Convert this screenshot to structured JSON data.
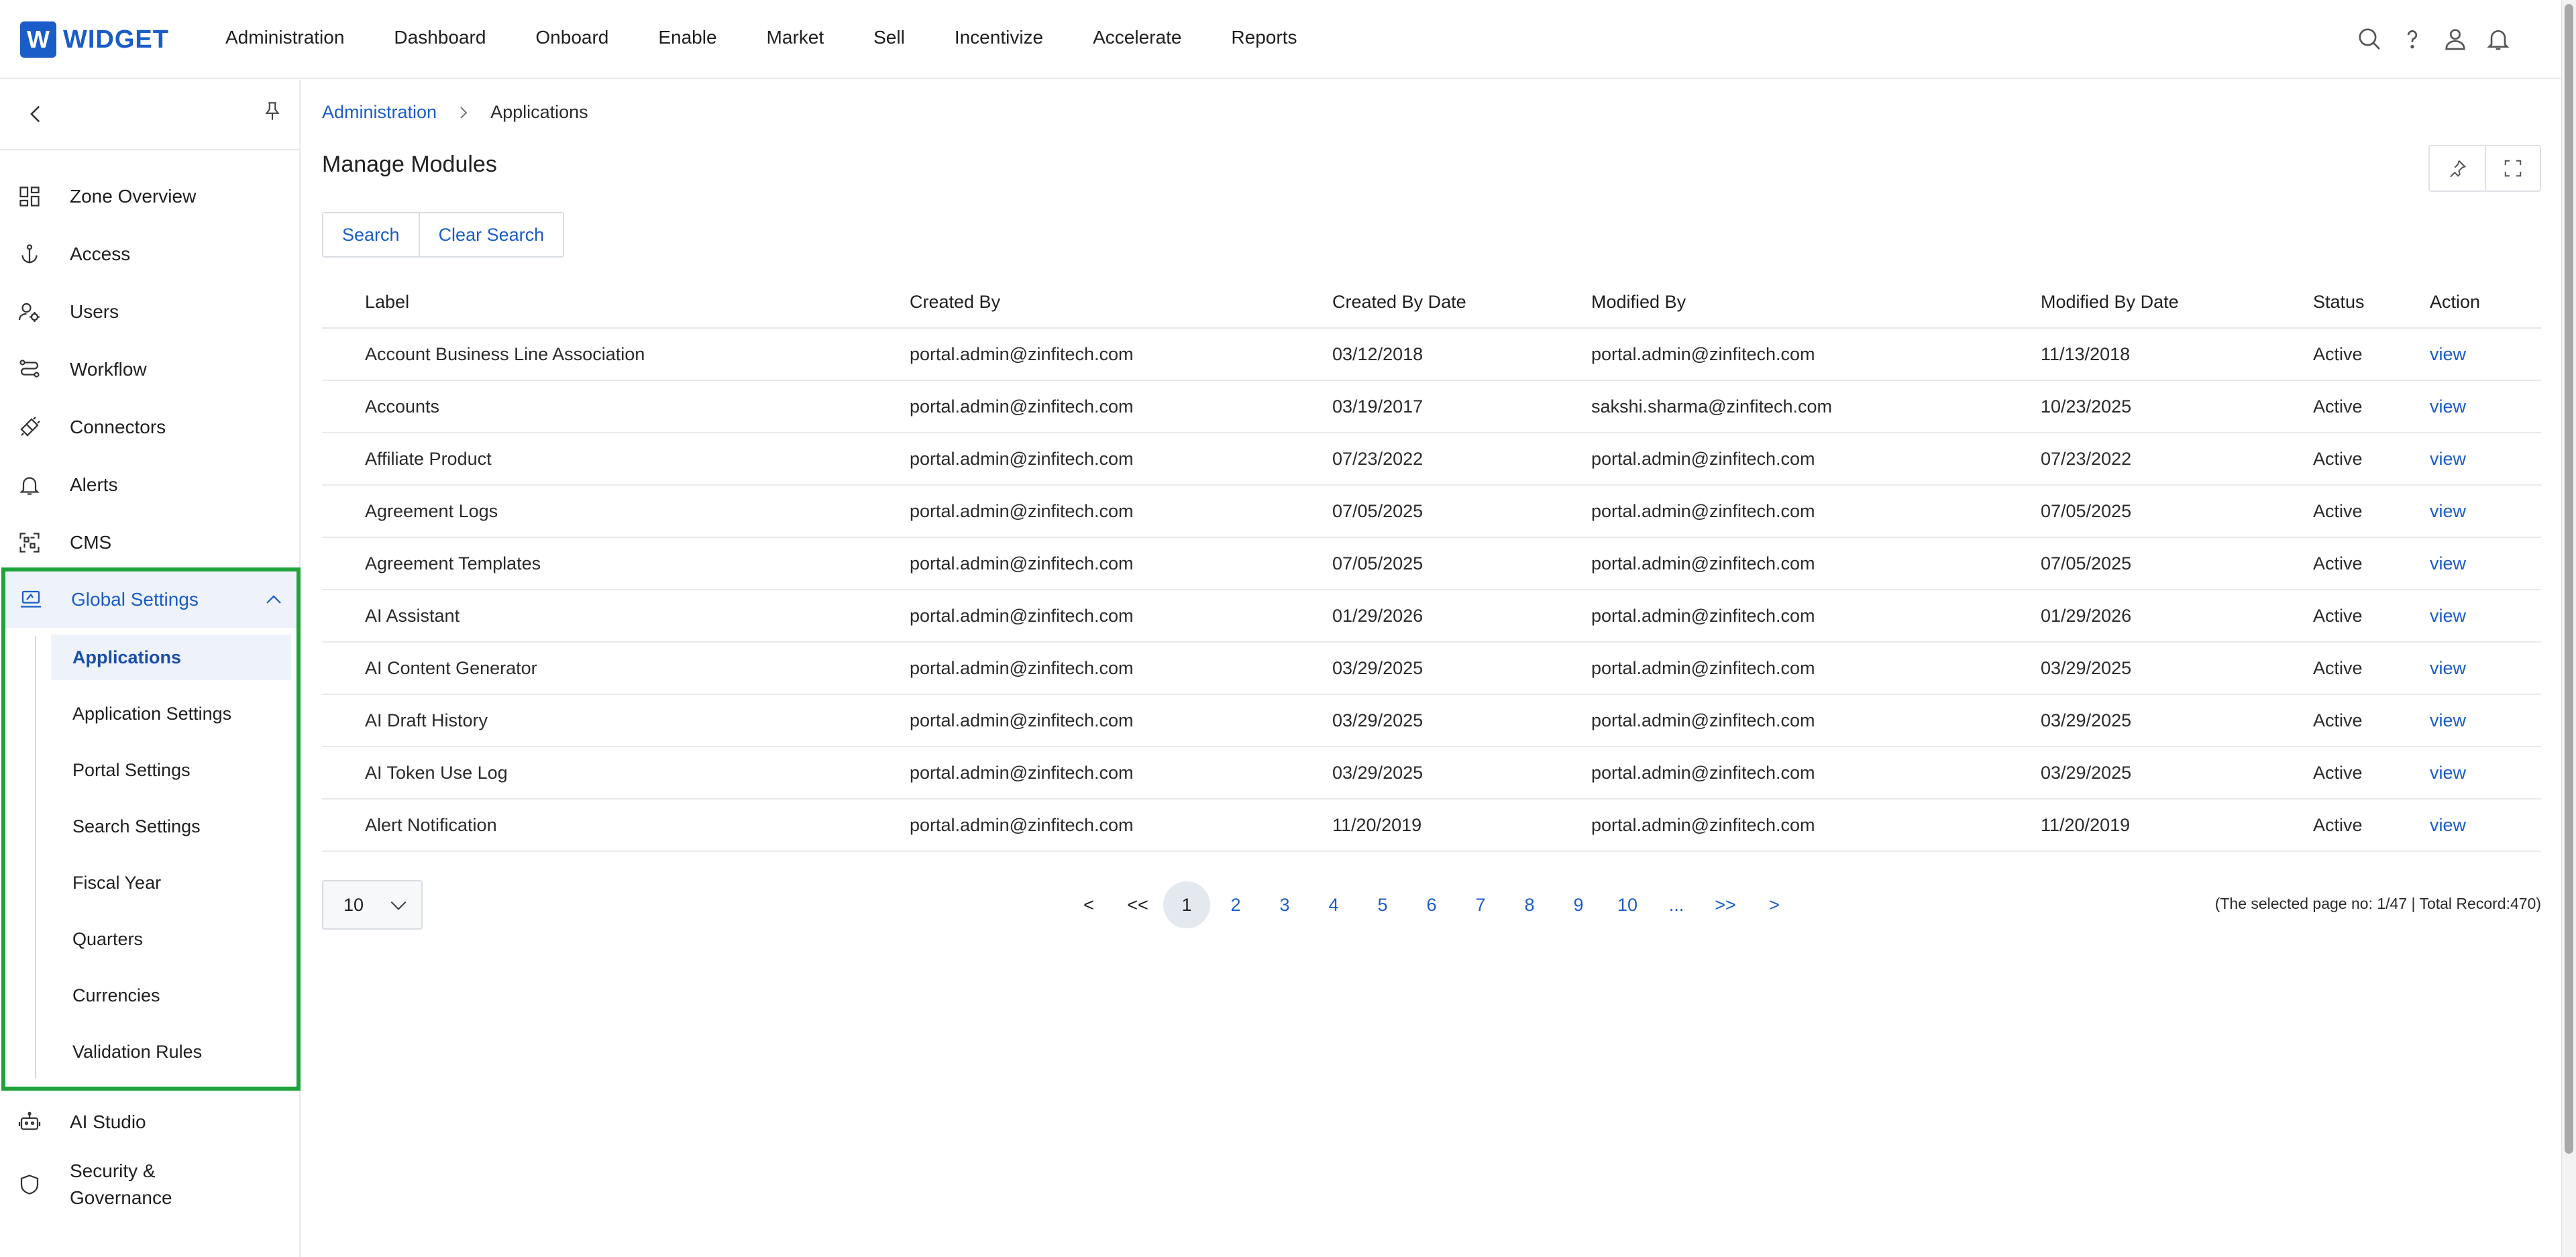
{
  "app": {
    "logo_letter": "W",
    "logo_text": "WIDGET",
    "brand_color": "#1a5cc8"
  },
  "topnav": {
    "items": [
      "Administration",
      "Dashboard",
      "Onboard",
      "Enable",
      "Market",
      "Sell",
      "Incentivize",
      "Accelerate",
      "Reports"
    ],
    "icons": [
      "search-icon",
      "help-icon",
      "user-icon",
      "bell-icon"
    ]
  },
  "sidebar": {
    "items": [
      {
        "label": "Zone Overview",
        "icon": "grid-icon"
      },
      {
        "label": "Access",
        "icon": "anchor-icon"
      },
      {
        "label": "Users",
        "icon": "users-gear-icon"
      },
      {
        "label": "Workflow",
        "icon": "workflow-icon"
      },
      {
        "label": "Connectors",
        "icon": "plug-icon"
      },
      {
        "label": "Alerts",
        "icon": "bell-icon"
      },
      {
        "label": "CMS",
        "icon": "qr-icon"
      }
    ],
    "expanded_group": {
      "label": "Global Settings",
      "icon": "laptop-settings-icon",
      "highlight_color": "#1fa33a",
      "children": [
        "Applications",
        "Application Settings",
        "Portal Settings",
        "Search Settings",
        "Fiscal Year",
        "Quarters",
        "Currencies",
        "Validation Rules"
      ],
      "active_child": "Applications"
    },
    "bottom_items": [
      {
        "label": "AI Studio",
        "icon": "robot-icon"
      },
      {
        "label": "Security &",
        "label2": "Governance",
        "icon": "shield-icon"
      }
    ]
  },
  "breadcrumb": {
    "parent": "Administration",
    "current": "Applications"
  },
  "page": {
    "title": "Manage Modules"
  },
  "search": {
    "search_label": "Search",
    "clear_label": "Clear Search"
  },
  "table": {
    "columns": [
      "Label",
      "Created By",
      "Created By Date",
      "Modified By",
      "Modified By Date",
      "Status",
      "Action"
    ],
    "rows": [
      [
        "Account Business Line Association",
        "portal.admin@zinfitech.com",
        "03/12/2018",
        "portal.admin@zinfitech.com",
        "11/13/2018",
        "Active",
        "view"
      ],
      [
        "Accounts",
        "portal.admin@zinfitech.com",
        "03/19/2017",
        "sakshi.sharma@zinfitech.com",
        "10/23/2025",
        "Active",
        "view"
      ],
      [
        "Affiliate Product",
        "portal.admin@zinfitech.com",
        "07/23/2022",
        "portal.admin@zinfitech.com",
        "07/23/2022",
        "Active",
        "view"
      ],
      [
        "Agreement Logs",
        "portal.admin@zinfitech.com",
        "07/05/2025",
        "portal.admin@zinfitech.com",
        "07/05/2025",
        "Active",
        "view"
      ],
      [
        "Agreement Templates",
        "portal.admin@zinfitech.com",
        "07/05/2025",
        "portal.admin@zinfitech.com",
        "07/05/2025",
        "Active",
        "view"
      ],
      [
        "AI Assistant",
        "portal.admin@zinfitech.com",
        "01/29/2026",
        "portal.admin@zinfitech.com",
        "01/29/2026",
        "Active",
        "view"
      ],
      [
        "AI Content Generator",
        "portal.admin@zinfitech.com",
        "03/29/2025",
        "portal.admin@zinfitech.com",
        "03/29/2025",
        "Active",
        "view"
      ],
      [
        "AI Draft History",
        "portal.admin@zinfitech.com",
        "03/29/2025",
        "portal.admin@zinfitech.com",
        "03/29/2025",
        "Active",
        "view"
      ],
      [
        "AI Token Use Log",
        "portal.admin@zinfitech.com",
        "03/29/2025",
        "portal.admin@zinfitech.com",
        "03/29/2025",
        "Active",
        "view"
      ],
      [
        "Alert Notification",
        "portal.admin@zinfitech.com",
        "11/20/2019",
        "portal.admin@zinfitech.com",
        "11/20/2019",
        "Active",
        "view"
      ]
    ]
  },
  "pagination": {
    "page_size": "10",
    "prev": "<",
    "first": "<<",
    "pages": [
      "1",
      "2",
      "3",
      "4",
      "5",
      "6",
      "7",
      "8",
      "9",
      "10"
    ],
    "current_page": "1",
    "ellipsis": "...",
    "last": ">>",
    "next": ">",
    "info": "(The selected page no: 1/47 | Total Record:470)"
  }
}
